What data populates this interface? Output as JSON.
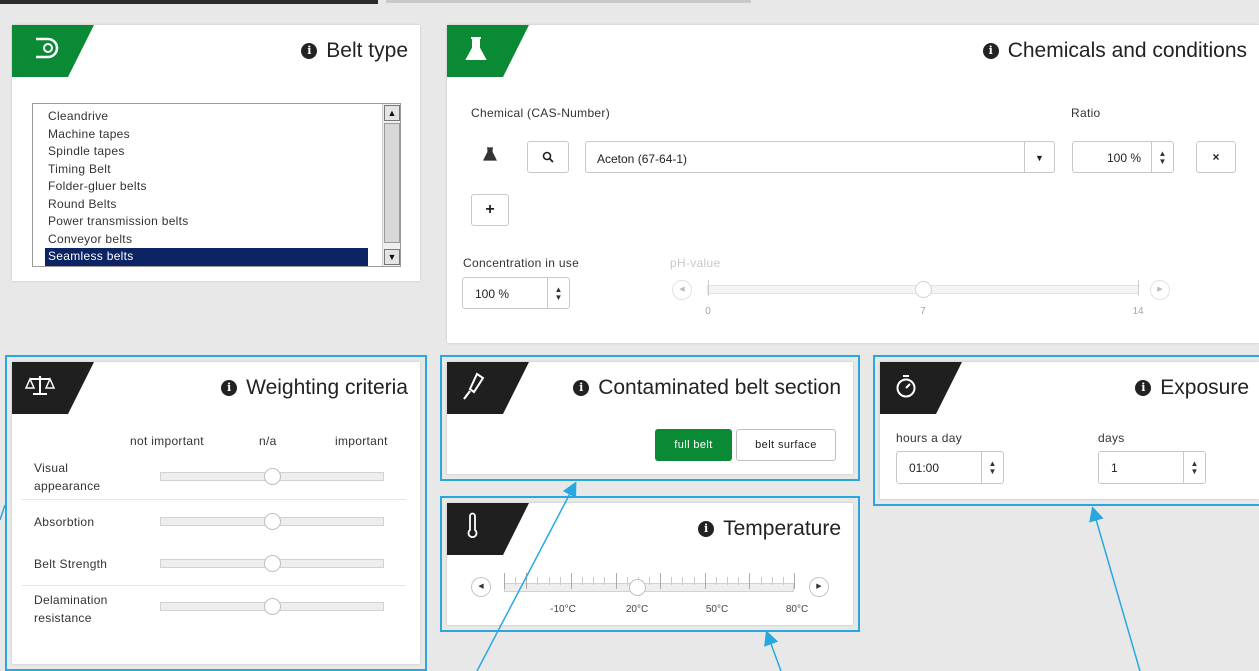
{
  "colors": {
    "green": "#0a8a34",
    "dark": "#1f1f1f",
    "highlight": "#29a8e0",
    "selected": "#0c2463"
  },
  "belt_type": {
    "title": "Belt type",
    "icon": "belt-roll-icon",
    "options": [
      "Cleandrive",
      "Machine tapes",
      "Spindle tapes",
      "Timing Belt",
      "Folder-gluer belts",
      "Round Belts",
      "Power transmission belts",
      "Conveyor belts",
      "Seamless belts"
    ],
    "selected": "Seamless belts"
  },
  "chemicals": {
    "title": "Chemicals and conditions",
    "icon": "flask-icon",
    "chemical_label": "Chemical (CAS-Number)",
    "ratio_label": "Ratio",
    "chemical_value": "Aceton (67-64-1)",
    "ratio_value": "100 %",
    "add_label": "+",
    "remove_label": "×",
    "concentration_label": "Concentration in use",
    "concentration_value": "100 %",
    "ph_label": "pH-value",
    "ph_ticks": [
      "0",
      "7",
      "14"
    ],
    "ph_value": 7
  },
  "weighting": {
    "title": "Weighting criteria",
    "icon": "balance-scale-icon",
    "scale_labels": [
      "not important",
      "n/a",
      "important"
    ],
    "criteria": [
      {
        "label": "Visual appearance",
        "value": 0.5
      },
      {
        "label": "Absorbtion",
        "value": 0.5
      },
      {
        "label": "Belt Strength",
        "value": 0.5
      },
      {
        "label": "Delamination resistance",
        "value": 0.5
      }
    ]
  },
  "contaminated": {
    "title": "Contaminated belt section",
    "icon": "spray-icon",
    "options": [
      "full belt",
      "belt surface"
    ],
    "active": "full belt"
  },
  "temperature": {
    "title": "Temperature",
    "icon": "thermometer-icon",
    "ticks": [
      "-10°C",
      "20°C",
      "50°C",
      "80°C"
    ],
    "value": "20°C"
  },
  "exposure": {
    "title": "Exposure",
    "icon": "stopwatch-icon",
    "hours_label": "hours a day",
    "hours_value": "01:00",
    "days_label": "days",
    "days_value": "1"
  }
}
